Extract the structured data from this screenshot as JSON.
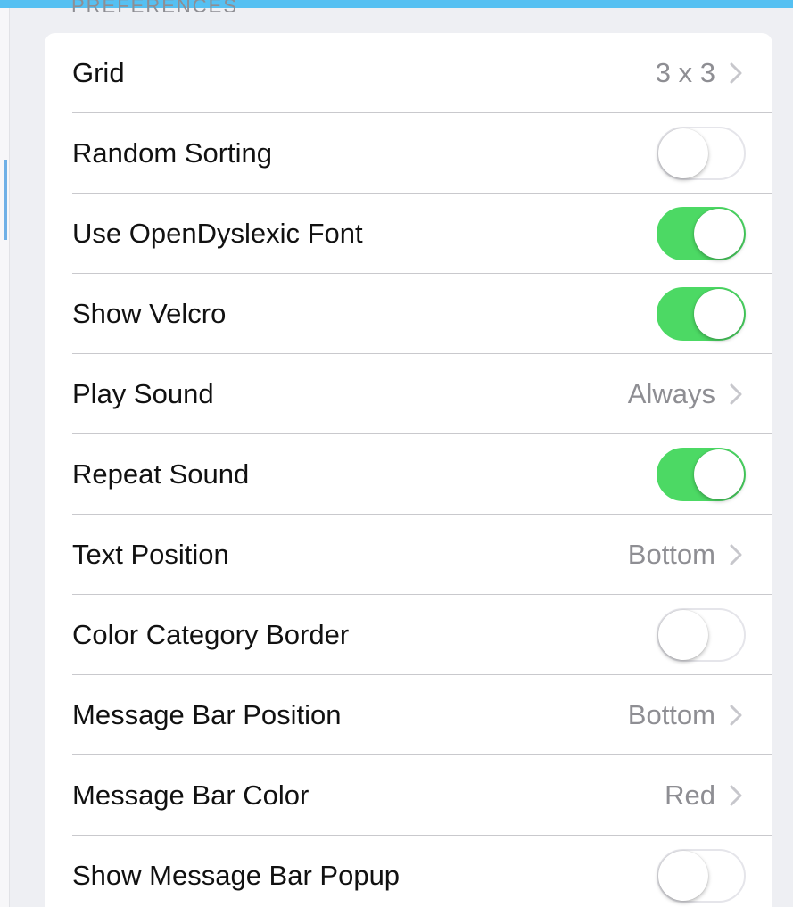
{
  "section": {
    "title": "Preferences"
  },
  "colors": {
    "toggle_on": "#4cd964",
    "top_bar": "#55c0f2"
  },
  "rows": [
    {
      "label": "Grid",
      "value": "3 x 3",
      "kind": "disclosure"
    },
    {
      "label": "Random Sorting",
      "kind": "toggle",
      "on": false
    },
    {
      "label": "Use OpenDyslexic Font",
      "kind": "toggle",
      "on": true
    },
    {
      "label": "Show Velcro",
      "kind": "toggle",
      "on": true
    },
    {
      "label": "Play Sound",
      "value": "Always",
      "kind": "disclosure"
    },
    {
      "label": "Repeat Sound",
      "kind": "toggle",
      "on": true
    },
    {
      "label": "Text Position",
      "value": "Bottom",
      "kind": "disclosure"
    },
    {
      "label": "Color Category Border",
      "kind": "toggle",
      "on": false
    },
    {
      "label": "Message Bar Position",
      "value": "Bottom",
      "kind": "disclosure"
    },
    {
      "label": "Message Bar Color",
      "value": "Red",
      "kind": "disclosure"
    },
    {
      "label": "Show Message Bar Popup",
      "kind": "toggle",
      "on": false
    }
  ]
}
